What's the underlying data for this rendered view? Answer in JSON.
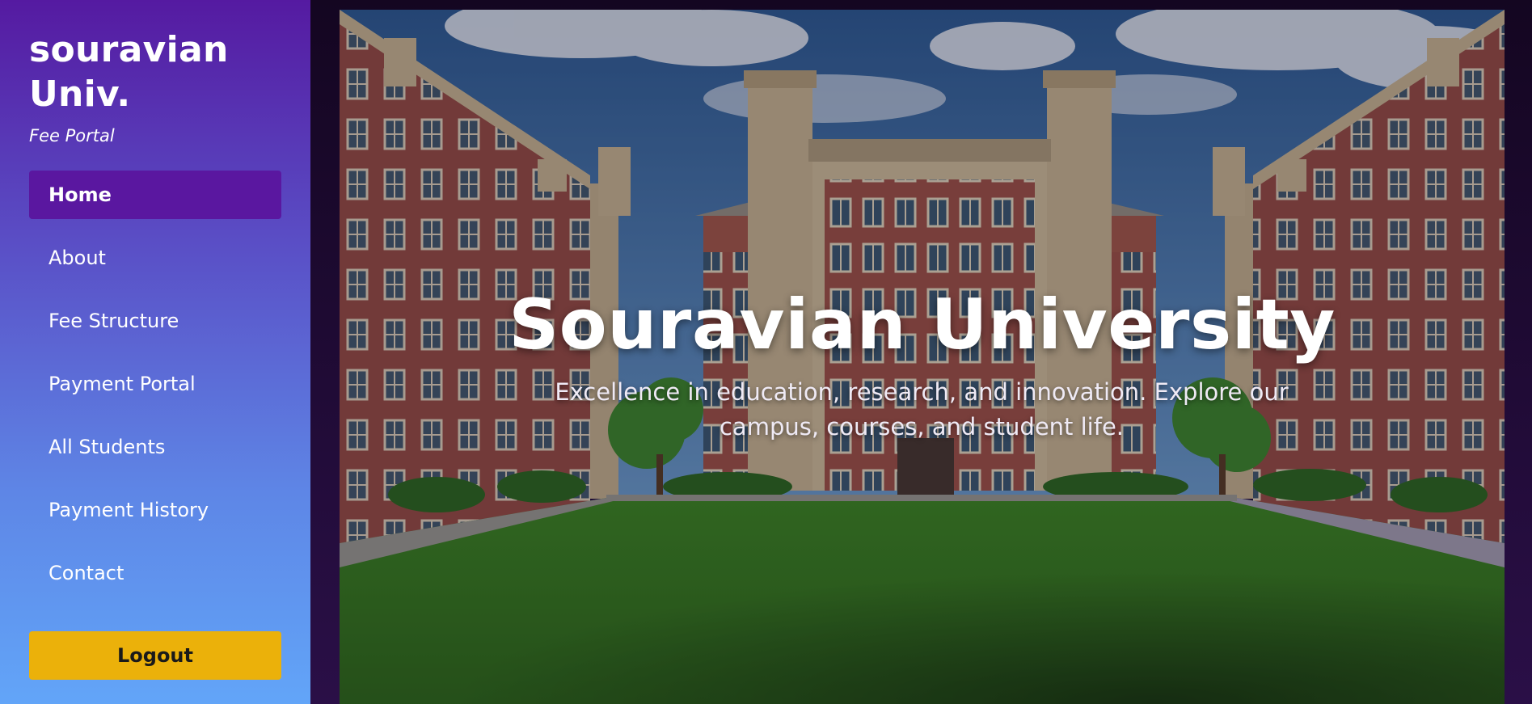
{
  "sidebar": {
    "brand_title": "souravian\nUniv.",
    "brand_subtitle": "Fee Portal",
    "nav": [
      {
        "label": "Home",
        "active": true
      },
      {
        "label": "About"
      },
      {
        "label": "Fee Structure"
      },
      {
        "label": "Payment Portal"
      },
      {
        "label": "All Students"
      },
      {
        "label": "Payment History"
      },
      {
        "label": "Contact"
      }
    ],
    "logout_label": "Logout"
  },
  "hero": {
    "title": "Souravian University",
    "tagline": "Excellence in education, research, and innovation. Explore our campus, courses, and student life.",
    "image_icon": "campus-building-illustration"
  },
  "colors": {
    "sidebar_top": "#551aa1",
    "sidebar_bottom": "#62a5f8",
    "active_nav": "#5a17a0",
    "logout_button": "#ebb10a",
    "main_background": "#1c0b33"
  }
}
